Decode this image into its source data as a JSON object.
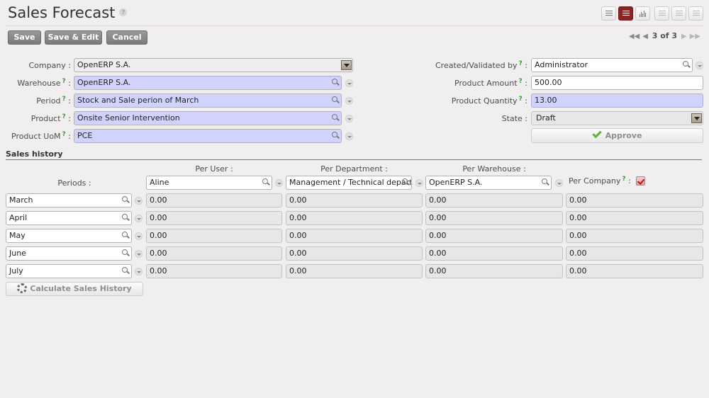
{
  "page": {
    "title": "Sales Forecast",
    "help": "?"
  },
  "toolbar": {
    "save": "Save",
    "save_edit": "Save & Edit",
    "cancel": "Cancel"
  },
  "pager": {
    "text": "3 of 3"
  },
  "views": [
    "list-view-icon",
    "form-view-icon",
    "graph-view-icon",
    "calendar-view-icon",
    "gantt-view-icon",
    "kanban-view-icon"
  ],
  "form": {
    "question": "?",
    "colon": ":",
    "company": {
      "label": "Company",
      "value": "OpenERP S.A."
    },
    "warehouse": {
      "label": "Warehouse",
      "value": "OpenERP S.A."
    },
    "period": {
      "label": "Period",
      "value": "Stock and Sale perion of March"
    },
    "product": {
      "label": "Product",
      "value": "Onsite Senior Intervention"
    },
    "uom": {
      "label": "Product UoM",
      "value": "PCE"
    },
    "created_by": {
      "label": "Created/Validated by",
      "value": "Administrator"
    },
    "amount": {
      "label": "Product Amount",
      "value": "500.00"
    },
    "quantity": {
      "label": "Product Quantity",
      "value": "13.00"
    },
    "state": {
      "label": "State",
      "value": "Draft"
    },
    "approve": "Approve"
  },
  "history": {
    "title": "Sales history",
    "periods_label": "Periods :",
    "per_user_label": "Per User :",
    "per_department_label": "Per Department :",
    "per_warehouse_label": "Per Warehouse :",
    "per_company_label": "Per Company",
    "user_value": "Aline",
    "department_value": "Management / Technical departm",
    "warehouse_value": "OpenERP S.A.",
    "per_company_checked": true,
    "rows": [
      {
        "period": "March",
        "user": "0.00",
        "dept": "0.00",
        "wh": "0.00",
        "company": "0.00"
      },
      {
        "period": "April",
        "user": "0.00",
        "dept": "0.00",
        "wh": "0.00",
        "company": "0.00"
      },
      {
        "period": "May",
        "user": "0.00",
        "dept": "0.00",
        "wh": "0.00",
        "company": "0.00"
      },
      {
        "period": "June",
        "user": "0.00",
        "dept": "0.00",
        "wh": "0.00",
        "company": "0.00"
      },
      {
        "period": "July",
        "user": "0.00",
        "dept": "0.00",
        "wh": "0.00",
        "company": "0.00"
      }
    ],
    "calculate": "Calculate Sales History"
  }
}
